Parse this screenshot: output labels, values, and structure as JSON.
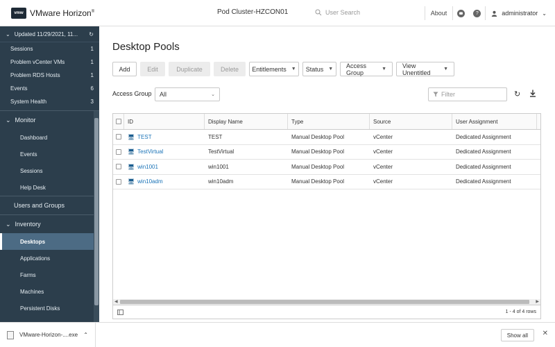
{
  "header": {
    "logo": "vmw",
    "app_title": "VMware Horizon",
    "trademark": "®",
    "pod": "Pod Cluster-HZCON01",
    "search_placeholder": "User Search",
    "about": "About",
    "chat_icon": "chat-icon",
    "help_icon": "?",
    "user": "administrator"
  },
  "sidebar": {
    "updated": "Updated 11/29/2021, 11...",
    "alerts": [
      {
        "label": "Sessions",
        "count": "1"
      },
      {
        "label": "Problem vCenter VMs",
        "count": "1"
      },
      {
        "label": "Problem RDS Hosts",
        "count": "1"
      },
      {
        "label": "Events",
        "count": "6"
      },
      {
        "label": "System Health",
        "count": "3"
      }
    ],
    "monitor": {
      "label": "Monitor",
      "items": [
        "Dashboard",
        "Events",
        "Sessions",
        "Help Desk"
      ]
    },
    "users_groups": "Users and Groups",
    "inventory": {
      "label": "Inventory",
      "items": [
        "Desktops",
        "Applications",
        "Farms",
        "Machines",
        "Persistent Disks"
      ]
    }
  },
  "main": {
    "title": "Desktop Pools",
    "toolbar": {
      "add": "Add",
      "edit": "Edit",
      "duplicate": "Duplicate",
      "delete": "Delete",
      "entitlements": "Entitlements",
      "status": "Status",
      "access_group": "Access Group",
      "view_unentitled": "View Unentitled"
    },
    "access_group_label": "Access Group",
    "access_group_value": "All",
    "filter_placeholder": "Filter",
    "columns": [
      "ID",
      "Display Name",
      "Type",
      "Source",
      "User Assignment"
    ],
    "rows": [
      {
        "id": "TEST",
        "display_name": "TEST",
        "type": "Manual Desktop Pool",
        "source": "vCenter",
        "assignment": "Dedicated Assignment"
      },
      {
        "id": "TestVirtual",
        "display_name": "TestVirtual",
        "type": "Manual Desktop Pool",
        "source": "vCenter",
        "assignment": "Dedicated Assignment"
      },
      {
        "id": "win1001",
        "display_name": "win1001",
        "type": "Manual Desktop Pool",
        "source": "vCenter",
        "assignment": "Dedicated Assignment"
      },
      {
        "id": "win10adm",
        "display_name": "win10adm",
        "type": "Manual Desktop Pool",
        "source": "vCenter",
        "assignment": "Dedicated Assignment"
      }
    ],
    "row_count": "1 - 4 of 4 rows"
  },
  "download_bar": {
    "file": "VMware-Horizon-....exe",
    "show_all": "Show all"
  },
  "colors": {
    "sidebar_bg": "#2c3e4c",
    "sidebar_active": "#4c6b84",
    "link": "#1a73b7"
  }
}
